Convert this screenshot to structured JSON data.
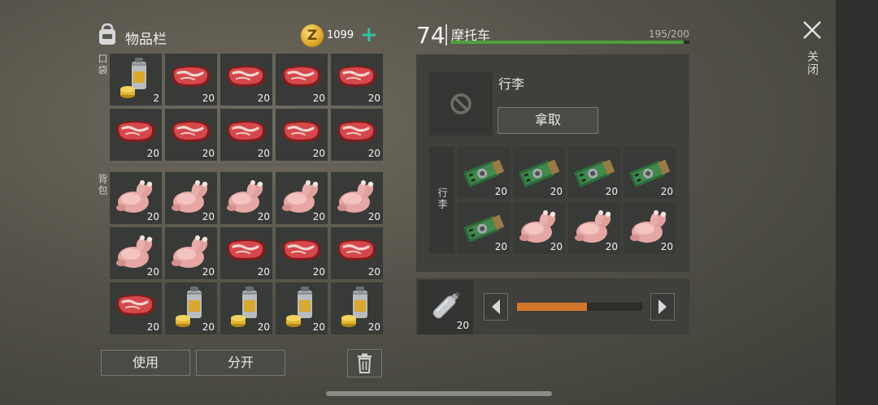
{
  "inventory": {
    "title": "物品栏",
    "currency_amount": "1099",
    "add_currency_symbol": "+",
    "coin_glyph": "Z",
    "pocket_label": "口袋",
    "backpack_label": "背包",
    "pocket_slots": [
      {
        "item": "paint-spray-can",
        "qty": "2"
      },
      {
        "item": "raw-steak",
        "qty": "20"
      },
      {
        "item": "raw-steak",
        "qty": "20"
      },
      {
        "item": "raw-steak",
        "qty": "20"
      },
      {
        "item": "raw-steak",
        "qty": "20"
      },
      {
        "item": "raw-steak",
        "qty": "20"
      },
      {
        "item": "raw-steak",
        "qty": "20"
      },
      {
        "item": "raw-steak",
        "qty": "20"
      },
      {
        "item": "raw-steak",
        "qty": "20"
      },
      {
        "item": "raw-steak",
        "qty": "20"
      }
    ],
    "backpack_slots": [
      {
        "item": "raw-chicken",
        "qty": "20"
      },
      {
        "item": "raw-chicken",
        "qty": "20"
      },
      {
        "item": "raw-chicken",
        "qty": "20"
      },
      {
        "item": "raw-chicken",
        "qty": "20"
      },
      {
        "item": "raw-chicken",
        "qty": "20"
      },
      {
        "item": "raw-chicken",
        "qty": "20"
      },
      {
        "item": "raw-chicken",
        "qty": "20"
      },
      {
        "item": "raw-steak",
        "qty": "20"
      },
      {
        "item": "raw-steak",
        "qty": "20"
      },
      {
        "item": "raw-steak",
        "qty": "20"
      },
      {
        "item": "raw-steak",
        "qty": "20"
      },
      {
        "item": "paint-spray-can",
        "qty": "20"
      },
      {
        "item": "paint-spray-can",
        "qty": "20"
      },
      {
        "item": "paint-spray-can",
        "qty": "20"
      },
      {
        "item": "paint-spray-can",
        "qty": "20"
      }
    ],
    "use_label": "使用",
    "split_label": "分开"
  },
  "vehicle": {
    "level": "74",
    "name": "摩托车",
    "durability_text": "195/200",
    "durability_fraction": 0.975,
    "luggage_title": "行李",
    "take_label": "拿取",
    "luggage_side_label": "行李",
    "luggage_slots": [
      {
        "item": "circuit-board",
        "qty": "20"
      },
      {
        "item": "circuit-board",
        "qty": "20"
      },
      {
        "item": "circuit-board",
        "qty": "20"
      },
      {
        "item": "circuit-board",
        "qty": "20"
      },
      {
        "item": "circuit-board",
        "qty": "20"
      },
      {
        "item": "raw-chicken",
        "qty": "20"
      },
      {
        "item": "raw-chicken",
        "qty": "20"
      },
      {
        "item": "raw-chicken",
        "qty": "20"
      }
    ],
    "fuel_item": {
      "item": "fuel-bottle",
      "qty": "20"
    },
    "fuel_fraction": 0.56
  },
  "close_label": "关闭",
  "colors": {
    "accent": "#36c2a2",
    "durability": "#4ea03c",
    "fuel": "#d4762a"
  }
}
